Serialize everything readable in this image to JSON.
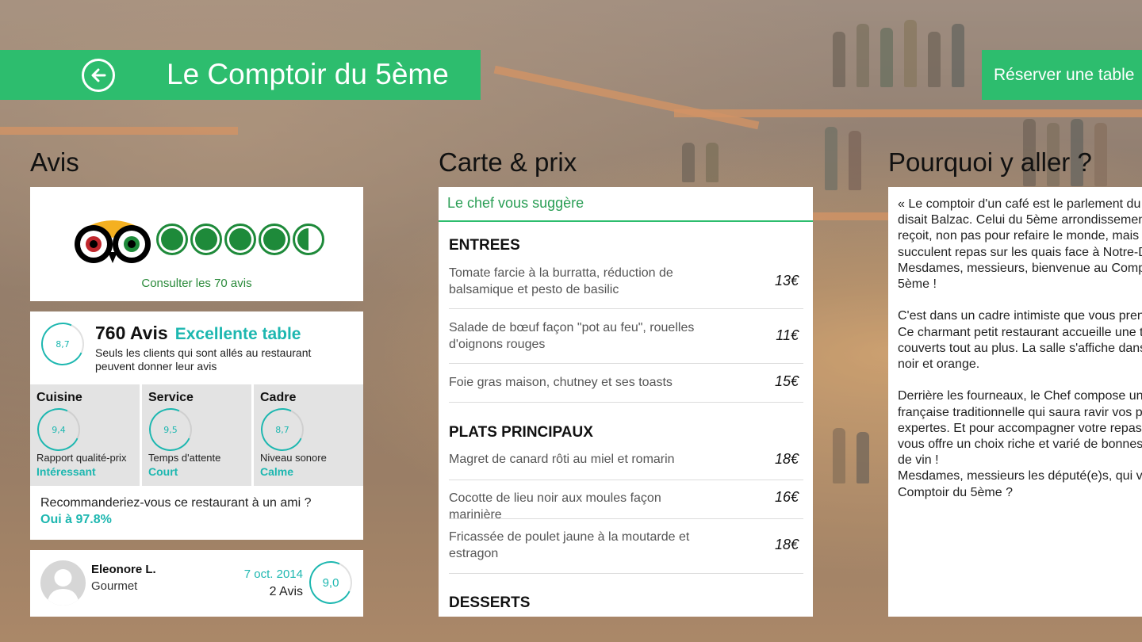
{
  "header": {
    "title": "Le Comptoir du 5ème",
    "reserve_label": "Réserver une table",
    "back_icon": "back-arrow-icon"
  },
  "colors": {
    "accent_green": "#2dbd6e",
    "teal": "#1db7b0",
    "tripadvisor_green": "#1e8a3a"
  },
  "sections": {
    "avis": "Avis",
    "carte": "Carte & prix",
    "pourquoi": "Pourquoi y aller ?"
  },
  "tripadvisor": {
    "rating_bubbles": 4.5,
    "link": "Consulter les 70 avis"
  },
  "summary": {
    "score": "8,7",
    "count": "760 Avis",
    "quality": "Excellente table",
    "description": "Seuls les clients qui sont allés au restaurant peuvent donner leur avis",
    "criteria": [
      {
        "title": "Cuisine",
        "score": "9,4",
        "label": "Rapport qualité-prix",
        "value": "Intéressant"
      },
      {
        "title": "Service",
        "score": "9,5",
        "label": "Temps d'attente",
        "value": "Court"
      },
      {
        "title": "Cadre",
        "score": "8,7",
        "label": "Niveau sonore",
        "value": "Calme"
      }
    ],
    "recommend_question": "Recommanderiez-vous ce restaurant à un ami ?",
    "recommend_answer": "Oui à 97.8%"
  },
  "review": {
    "name": "Eleonore L.",
    "type": "Gourmet",
    "date": "7 oct. 2014",
    "count": "2 Avis",
    "score": "9,0"
  },
  "menu": {
    "tab": "Le chef vous suggère",
    "entrees_title": "ENTREES",
    "entrees": [
      {
        "name": "Tomate farcie à la burratta, réduction de balsamique et pesto de basilic",
        "price": "13€"
      },
      {
        "name": "Salade de bœuf façon \"pot au feu\", rouelles d'oignons rouges",
        "price": "11€"
      },
      {
        "name": "Foie gras maison, chutney et ses toasts",
        "price": "15€"
      }
    ],
    "plats_title": "PLATS PRINCIPAUX",
    "plats": [
      {
        "name": "Magret de canard rôti au miel et romarin",
        "price": "18€"
      },
      {
        "name": "Cocotte de lieu noir aux moules façon marinière",
        "price": "16€"
      },
      {
        "name": "Fricassée de poulet jaune à la moutarde et estragon",
        "price": "18€"
      }
    ],
    "desserts_title": "DESSERTS"
  },
  "why": {
    "text": "« Le comptoir d'un café est le parlement du peuple » disait Balzac. Celui du 5ème arrondissement vous reçoit, non pas pour refaire le monde, mais pour un succulent repas sur les quais face à Notre-Dame. Mesdames, messieurs, bienvenue au Comptoir du 5ème !\n\nC'est dans un cadre intimiste que vous prendrez place. Ce charmant petit restaurant accueille une trentaine de couverts tout au plus. La salle s'affiche dans des tons noir et orange.\n\nDerrière les fourneaux, le Chef compose une cuisine française traditionnelle qui saura ravir vos papilles expertes. Et pour accompagner votre repas, la carte vous offre un choix riche et varié de bonnes bouteilles de vin !\nMesdames, messieurs les député(e)s, qui viendra au Comptoir du 5ème ?"
  }
}
